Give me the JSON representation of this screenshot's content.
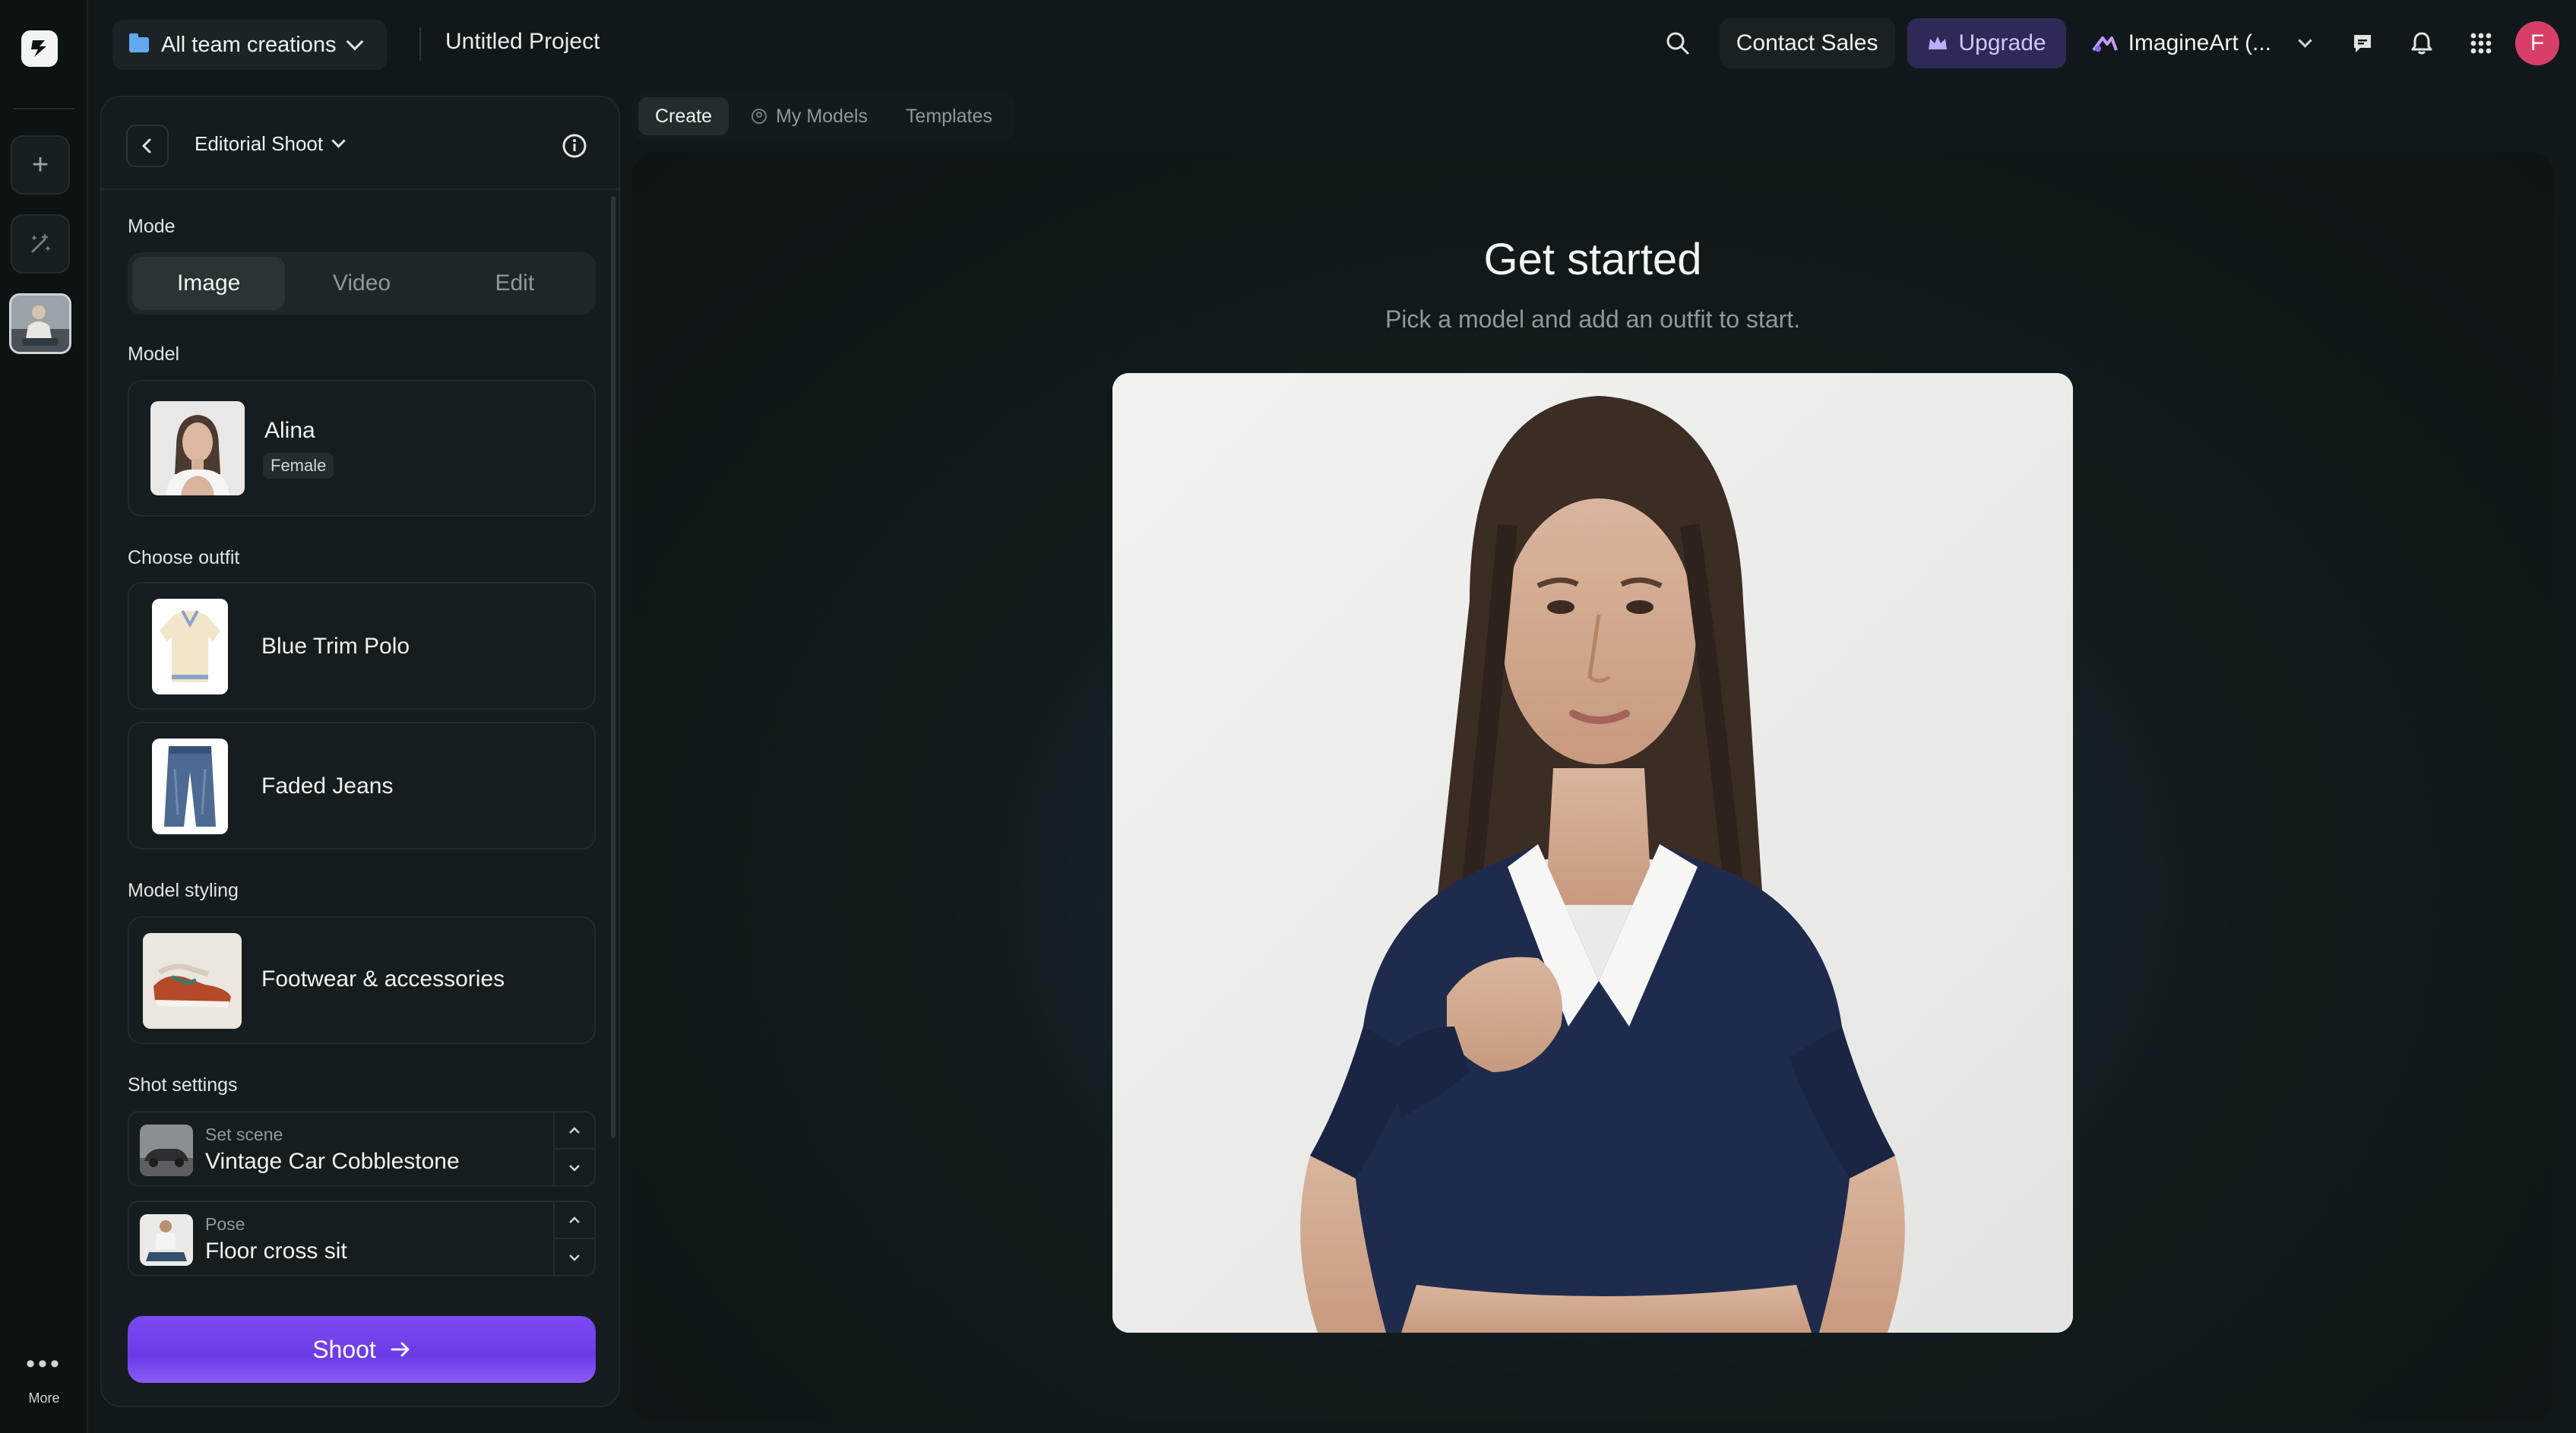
{
  "topbar": {
    "team_select": "All team creations",
    "project_title": "Untitled Project",
    "contact_sales": "Contact Sales",
    "upgrade": "Upgrade",
    "workspace": "ImagineArt (...",
    "avatar_initial": "F"
  },
  "rail": {
    "more_label": "More"
  },
  "panel": {
    "title": "Editorial Shoot",
    "mode_label": "Mode",
    "modes": [
      "Image",
      "Video",
      "Edit"
    ],
    "active_mode": "Image",
    "model_label": "Model",
    "model": {
      "name": "Alina",
      "gender": "Female"
    },
    "outfit_label": "Choose outfit",
    "outfits": [
      "Blue Trim Polo",
      "Faded Jeans"
    ],
    "styling_label": "Model styling",
    "styling_item": "Footwear & accessories",
    "shot_label": "Shot settings",
    "scene": {
      "label": "Set scene",
      "value": "Vintage Car Cobblestone"
    },
    "pose": {
      "label": "Pose",
      "value": "Floor cross sit"
    },
    "shoot_button": "Shoot"
  },
  "canvas": {
    "tabs": [
      "Create",
      "My Models",
      "Templates"
    ],
    "active_tab": "Create",
    "heading": "Get started",
    "subheading": "Pick a model and add an outfit to start."
  },
  "colors": {
    "accent": "#7b4af0",
    "upgrade_bg": "#2d2a58",
    "avatar": "#d73f68",
    "background": "#11181b"
  },
  "icons": [
    "logo-icon",
    "plus-icon",
    "magic-icon",
    "folder-icon",
    "search-icon",
    "crown-icon",
    "imagineart-icon",
    "chat-icon",
    "bell-icon",
    "grid-icon",
    "chevron-left-icon",
    "info-icon",
    "chevron-down-icon",
    "chevron-up-icon",
    "arrow-right-icon",
    "models-icon",
    "more-dots-icon"
  ]
}
